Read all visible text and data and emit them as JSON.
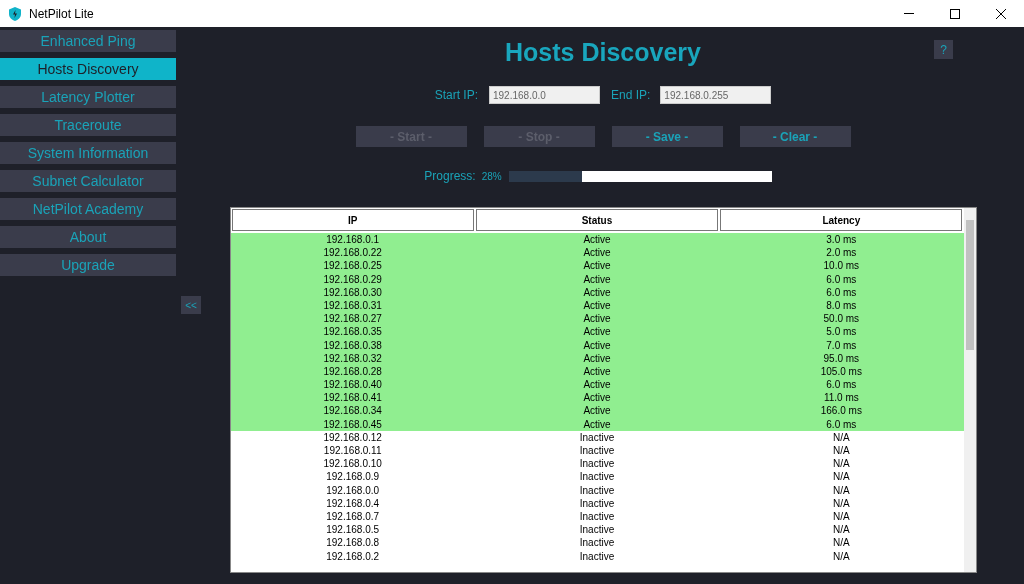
{
  "window": {
    "title": "NetPilot Lite"
  },
  "sidebar": {
    "items": [
      {
        "label": "Enhanced Ping",
        "selected": false
      },
      {
        "label": "Hosts Discovery",
        "selected": true
      },
      {
        "label": "Latency Plotter",
        "selected": false
      },
      {
        "label": "Traceroute",
        "selected": false
      },
      {
        "label": "System Information",
        "selected": false
      },
      {
        "label": "Subnet Calculator",
        "selected": false
      },
      {
        "label": "NetPilot Academy",
        "selected": false
      },
      {
        "label": "About",
        "selected": false
      },
      {
        "label": "Upgrade",
        "selected": false
      }
    ],
    "collapse_button": "<<"
  },
  "heading": "Hosts Discovery",
  "help_button": "?",
  "range": {
    "start_label": "Start IP:",
    "start_value": "192.168.0.0",
    "end_label": "End IP:",
    "end_value": "192.168.0.255"
  },
  "buttons": [
    {
      "label": "- Start -",
      "disabled": true
    },
    {
      "label": "- Stop -",
      "disabled": true
    },
    {
      "label": "- Save -",
      "disabled": false
    },
    {
      "label": "- Clear -",
      "disabled": false
    }
  ],
  "progress": {
    "label": "Progress:",
    "reading": "28%",
    "level": 0.28
  },
  "table": {
    "columns": [
      "IP",
      "Status",
      "Latency"
    ],
    "rows": [
      {
        "ip": "192.168.0.1",
        "status": "Active",
        "latency": "3.0 ms",
        "active": true
      },
      {
        "ip": "192.168.0.22",
        "status": "Active",
        "latency": "2.0 ms",
        "active": true
      },
      {
        "ip": "192.168.0.25",
        "status": "Active",
        "latency": "10.0 ms",
        "active": true
      },
      {
        "ip": "192.168.0.29",
        "status": "Active",
        "latency": "6.0 ms",
        "active": true
      },
      {
        "ip": "192.168.0.30",
        "status": "Active",
        "latency": "6.0 ms",
        "active": true
      },
      {
        "ip": "192.168.0.31",
        "status": "Active",
        "latency": "8.0 ms",
        "active": true
      },
      {
        "ip": "192.168.0.27",
        "status": "Active",
        "latency": "50.0 ms",
        "active": true
      },
      {
        "ip": "192.168.0.35",
        "status": "Active",
        "latency": "5.0 ms",
        "active": true
      },
      {
        "ip": "192.168.0.38",
        "status": "Active",
        "latency": "7.0 ms",
        "active": true
      },
      {
        "ip": "192.168.0.32",
        "status": "Active",
        "latency": "95.0 ms",
        "active": true
      },
      {
        "ip": "192.168.0.28",
        "status": "Active",
        "latency": "105.0 ms",
        "active": true
      },
      {
        "ip": "192.168.0.40",
        "status": "Active",
        "latency": "6.0 ms",
        "active": true
      },
      {
        "ip": "192.168.0.41",
        "status": "Active",
        "latency": "11.0 ms",
        "active": true
      },
      {
        "ip": "192.168.0.34",
        "status": "Active",
        "latency": "166.0 ms",
        "active": true
      },
      {
        "ip": "192.168.0.45",
        "status": "Active",
        "latency": "6.0 ms",
        "active": true
      },
      {
        "ip": "192.168.0.12",
        "status": "Inactive",
        "latency": "N/A",
        "active": false
      },
      {
        "ip": "192.168.0.11",
        "status": "Inactive",
        "latency": "N/A",
        "active": false
      },
      {
        "ip": "192.168.0.10",
        "status": "Inactive",
        "latency": "N/A",
        "active": false
      },
      {
        "ip": "192.168.0.9",
        "status": "Inactive",
        "latency": "N/A",
        "active": false
      },
      {
        "ip": "192.168.0.0",
        "status": "Inactive",
        "latency": "N/A",
        "active": false
      },
      {
        "ip": "192.168.0.4",
        "status": "Inactive",
        "latency": "N/A",
        "active": false
      },
      {
        "ip": "192.168.0.7",
        "status": "Inactive",
        "latency": "N/A",
        "active": false
      },
      {
        "ip": "192.168.0.5",
        "status": "Inactive",
        "latency": "N/A",
        "active": false
      },
      {
        "ip": "192.168.0.8",
        "status": "Inactive",
        "latency": "N/A",
        "active": false
      },
      {
        "ip": "192.168.0.2",
        "status": "Inactive",
        "latency": "N/A",
        "active": false
      }
    ]
  }
}
